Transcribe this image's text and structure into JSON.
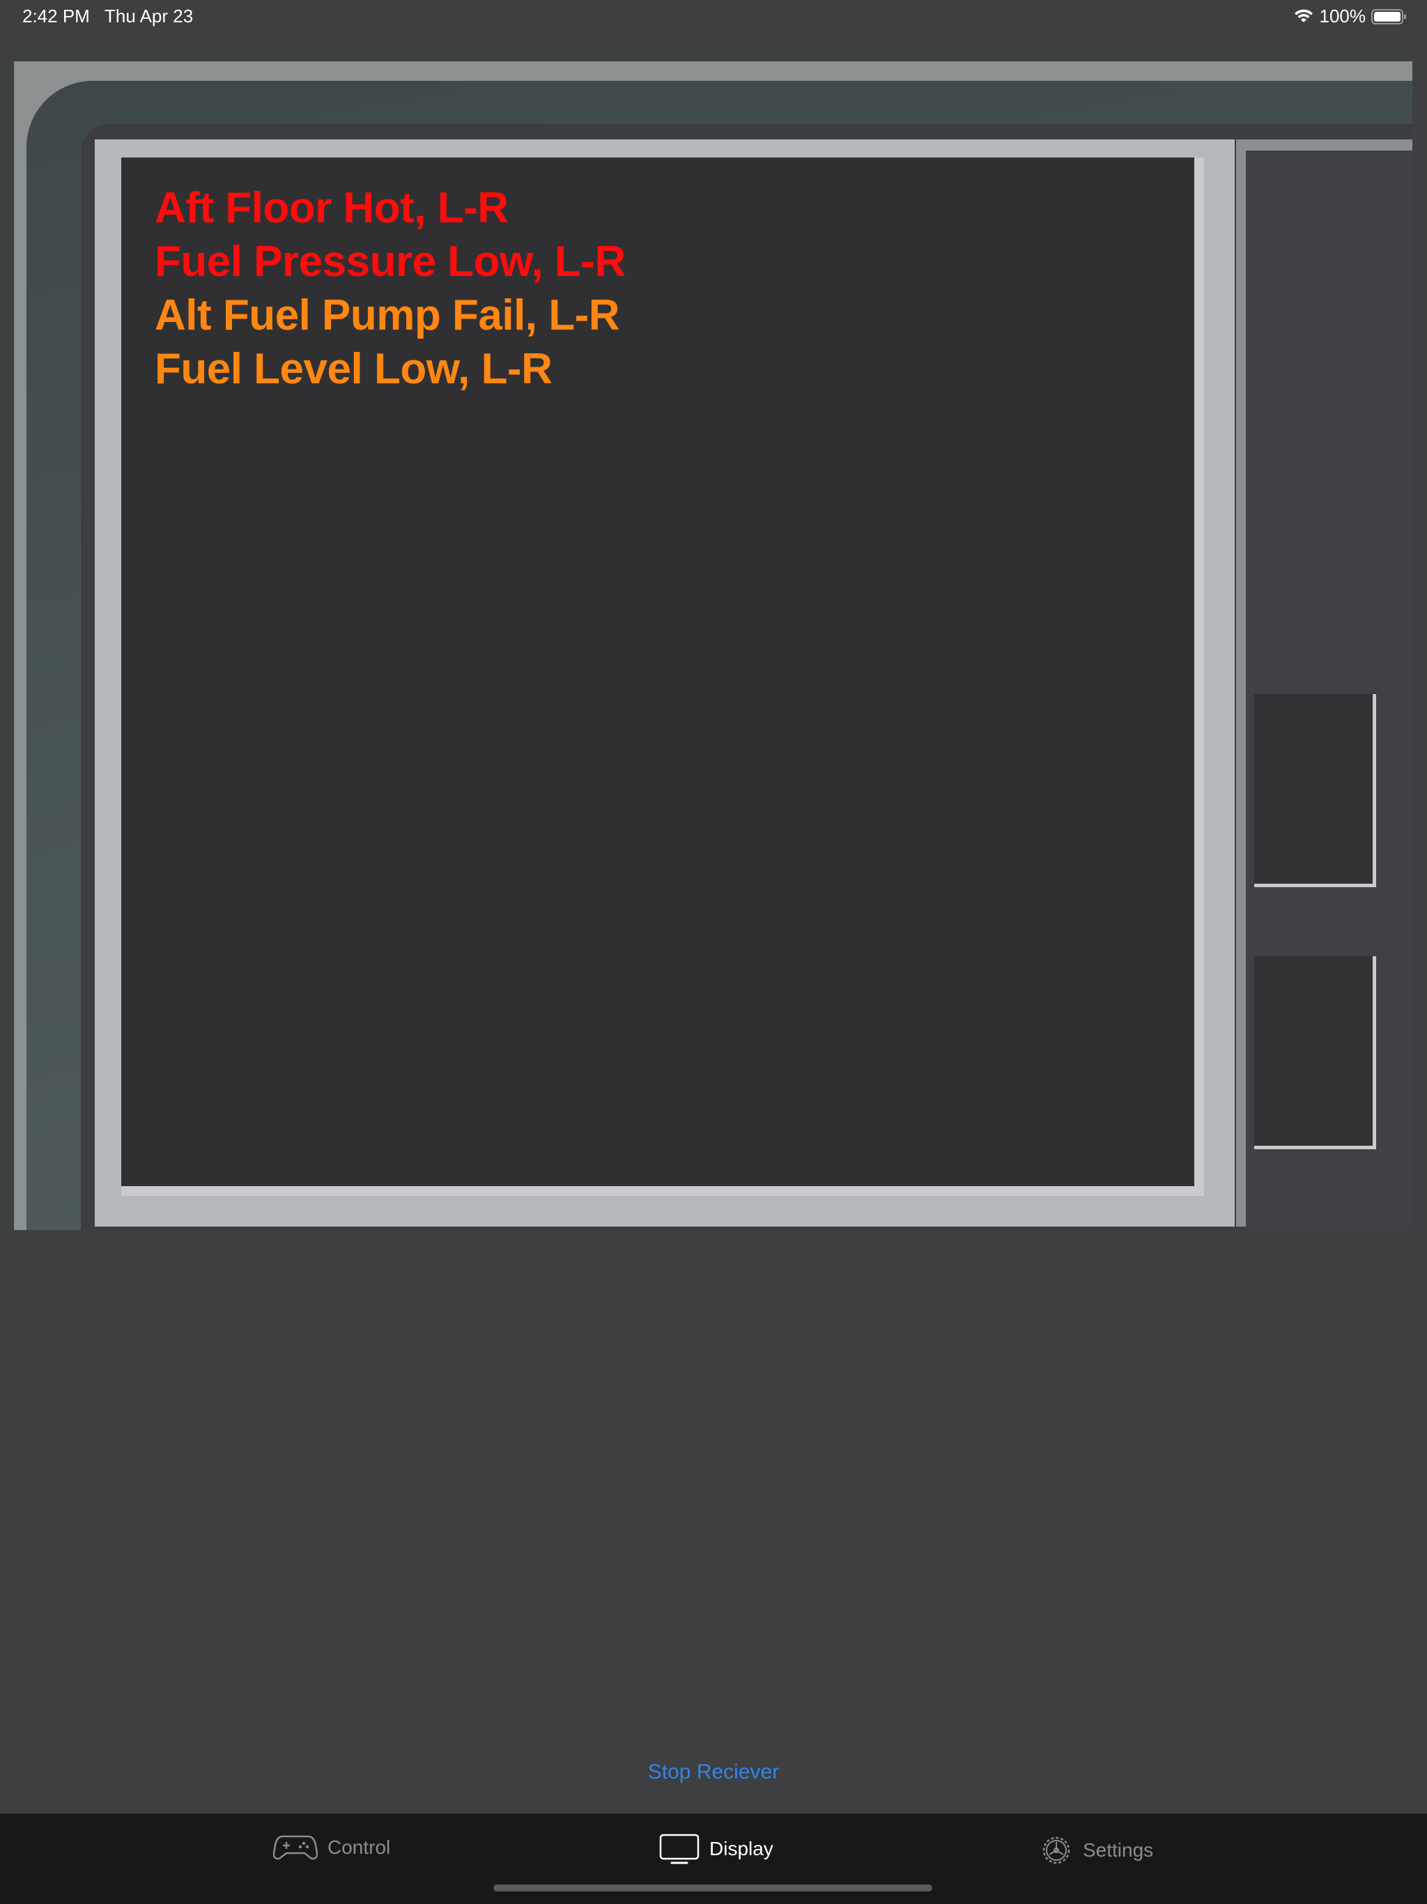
{
  "status_bar": {
    "time": "2:42 PM",
    "date": "Thu Apr 23",
    "battery": "100%"
  },
  "display": {
    "alerts": [
      {
        "text": "Aft Floor Hot, L-R",
        "color": "#ff0c0c"
      },
      {
        "text": "Fuel Pressure Low, L-R",
        "color": "#ff0c0c"
      },
      {
        "text": "Alt Fuel Pump Fail, L-R",
        "color": "#ff8712"
      },
      {
        "text": "Fuel Level Low, L-R",
        "color": "#ff8712"
      }
    ]
  },
  "stop_button": {
    "label": "Stop Reciever"
  },
  "tab_bar": {
    "tabs": [
      {
        "label": "Control",
        "icon": "gamecontroller-icon",
        "selected": false
      },
      {
        "label": "Display",
        "icon": "display-icon",
        "selected": true
      },
      {
        "label": "Settings",
        "icon": "gear-icon",
        "selected": false
      }
    ]
  },
  "colors": {
    "accent": "#2e86e8",
    "background": "#3e3f41",
    "tab_bar": "#181818"
  }
}
